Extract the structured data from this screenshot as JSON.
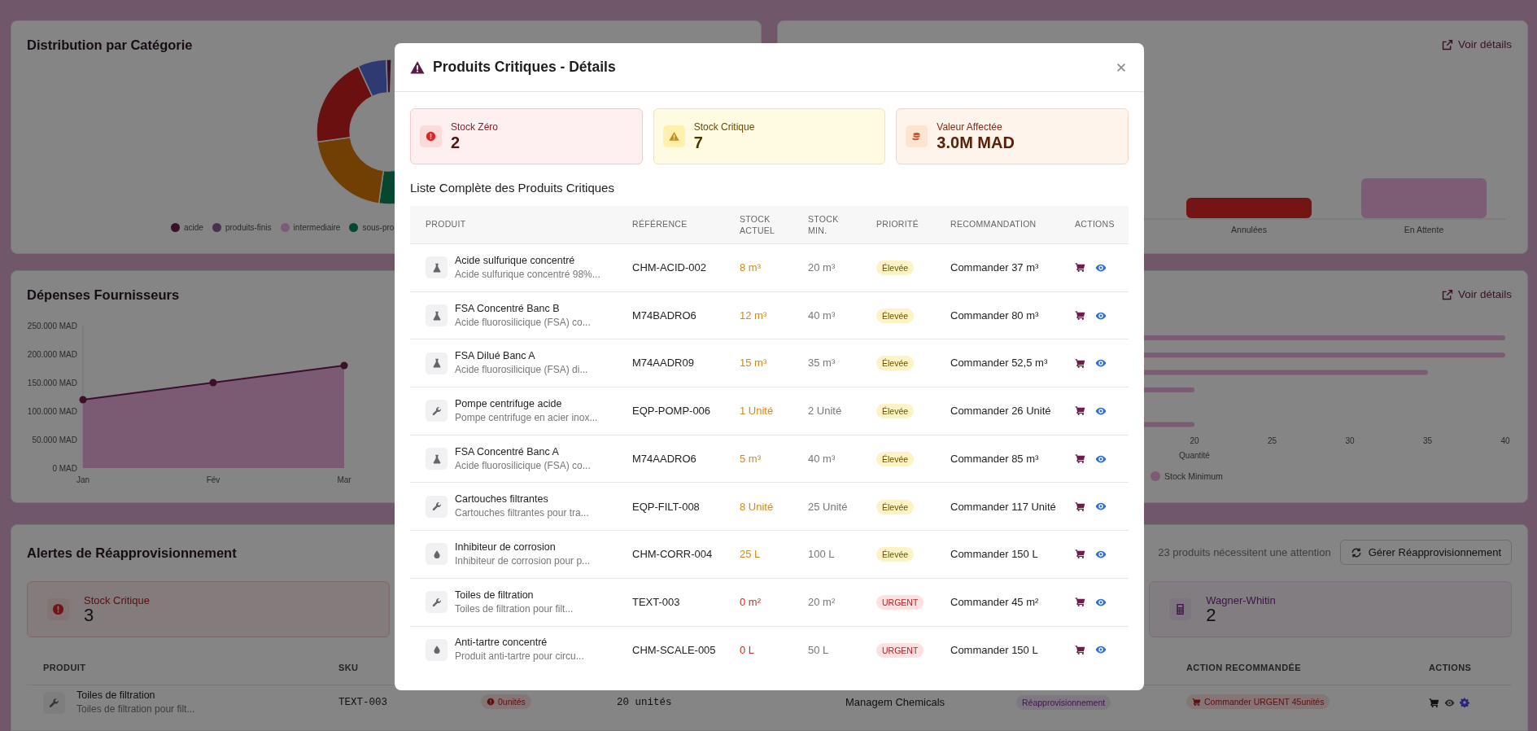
{
  "dashboard": {
    "category_card": {
      "title": "Distribution par Catégorie",
      "legend": [
        {
          "label": "acide",
          "color": "#3a1128"
        },
        {
          "label": "produits-finis",
          "color": "#4a3050"
        },
        {
          "label": "intermediaire",
          "color": "#7a5e75"
        },
        {
          "label": "sous-pro",
          "color": "#06472f"
        }
      ]
    },
    "orders_card": {
      "link": "Voir détails",
      "bars": [
        {
          "label": "Annulées",
          "color": "#741414"
        },
        {
          "label": "En Attente",
          "color": "#7d5c76"
        }
      ]
    },
    "expenses_card": {
      "title": "Dépenses Fournisseurs",
      "chart_data": {
        "type": "area",
        "categories": [
          "Jan",
          "Fév",
          "Mar"
        ],
        "ylim": [
          0,
          250
        ],
        "yticks": [
          {
            "value": 0,
            "label": "0 MAD"
          },
          {
            "value": 50,
            "label": "50.000 MAD"
          },
          {
            "value": 100,
            "label": "100.000 MAD"
          },
          {
            "value": 150,
            "label": "150.000 MAD"
          },
          {
            "value": 200,
            "label": "200.000 MAD"
          },
          {
            "value": 250,
            "label": "250.000 MAD"
          }
        ],
        "series": [
          {
            "color": "#3a1128",
            "values": [
              120,
              150,
              180
            ]
          }
        ]
      }
    },
    "stock_card": {
      "link": "Voir détails",
      "tick_labels": [
        "20",
        "25",
        "30",
        "35",
        "40"
      ],
      "axis_title": "Quantité",
      "legend": [
        {
          "label": "Stock Minimum",
          "color": "#7c5b74"
        }
      ]
    },
    "alerts_card": {
      "title": "Alertes de Réapprovisionnement",
      "summary": "23 produits nécessitent une attention",
      "button": "Gérer Réapprovisionnement",
      "stats": [
        {
          "kind": "critical",
          "label": "Stock Critique",
          "value": "3"
        },
        {
          "kind": "wagner",
          "label": "Wagner-Whitin",
          "value": "2"
        }
      ],
      "columns": [
        "PRODUIT",
        "SKU",
        "ACTION RECOMMANDÉE",
        "ACTIONS"
      ],
      "rows": [
        {
          "kind": "wrench",
          "name": "Toiles de filtration",
          "description": "Toiles de filtration pour filt...",
          "sku": "TEXT-003",
          "stock": "0unités",
          "minimum": "20 unités",
          "supplier": "Managem Chemicals",
          "method": "Réapprovisionnement",
          "action": "Commander URGENT 45unités"
        }
      ]
    }
  },
  "modal": {
    "title": "Produits Critiques - Détails",
    "stats": [
      {
        "kind": "zero",
        "label": "Stock Zéro",
        "value": "2"
      },
      {
        "kind": "critical",
        "label": "Stock Critique",
        "value": "7"
      },
      {
        "kind": "value",
        "label": "Valeur Affectée",
        "value": "3.0M MAD"
      }
    ],
    "list_title": "Liste Complète des Produits Critiques",
    "columns": [
      "PRODUIT",
      "RÉFÉRENCE",
      "STOCK ACTUEL",
      "STOCK MIN.",
      "PRIORITÉ",
      "RECOMMANDATION",
      "ACTIONS"
    ],
    "rows": [
      {
        "kind": "flask",
        "name": "Acide sulfurique concentré",
        "description": "Acide sulfurique concentré 98%...",
        "reference": "CHM-ACID-002",
        "stock": "8 m³",
        "minimum": "20 m³",
        "priority": {
          "label": "Élevée",
          "kind": "high"
        },
        "recommendation": "Commander 37 m³"
      },
      {
        "kind": "flask",
        "name": "FSA Concentré Banc B",
        "description": "Acide fluorosilicique (FSA) co...",
        "reference": "M74BADRO6",
        "stock": "12 m³",
        "minimum": "40 m³",
        "priority": {
          "label": "Élevée",
          "kind": "high"
        },
        "recommendation": "Commander 80 m³"
      },
      {
        "kind": "flask",
        "name": "FSA Dilué Banc A",
        "description": "Acide fluorosilicique (FSA) di...",
        "reference": "M74AADR09",
        "stock": "15 m³",
        "minimum": "35 m³",
        "priority": {
          "label": "Élevée",
          "kind": "high"
        },
        "recommendation": "Commander 52,5 m³"
      },
      {
        "kind": "wrench",
        "name": "Pompe centrifuge acide",
        "description": "Pompe centrifuge en acier inox...",
        "reference": "EQP-POMP-006",
        "stock": "1 Unité",
        "minimum": "2 Unité",
        "priority": {
          "label": "Élevée",
          "kind": "high"
        },
        "recommendation": "Commander 26 Unité"
      },
      {
        "kind": "flask",
        "name": "FSA Concentré Banc A",
        "description": "Acide fluorosilicique (FSA) co...",
        "reference": "M74AADRO6",
        "stock": "5 m³",
        "minimum": "40 m³",
        "priority": {
          "label": "Élevée",
          "kind": "high"
        },
        "recommendation": "Commander 85 m³"
      },
      {
        "kind": "wrench",
        "name": "Cartouches filtrantes",
        "description": "Cartouches filtrantes pour tra...",
        "reference": "EQP-FILT-008",
        "stock": "8 Unité",
        "minimum": "25 Unité",
        "priority": {
          "label": "Élevée",
          "kind": "high"
        },
        "recommendation": "Commander 117 Unité"
      },
      {
        "kind": "drop",
        "name": "Inhibiteur de corrosion",
        "description": "Inhibiteur de corrosion pour p...",
        "reference": "CHM-CORR-004",
        "stock": "25 L",
        "minimum": "100 L",
        "priority": {
          "label": "Élevée",
          "kind": "high"
        },
        "recommendation": "Commander 150 L"
      },
      {
        "kind": "wrench",
        "name": "Toiles de filtration",
        "description": "Toiles de filtration pour filt...",
        "reference": "TEXT-003",
        "stock": "0 m²",
        "minimum": "20 m²",
        "priority": {
          "label": "URGENT",
          "kind": "urgent"
        },
        "recommendation": "Commander 45 m²"
      },
      {
        "kind": "drop",
        "name": "Anti-tartre concentré",
        "description": "Produit anti-tartre pour circu...",
        "reference": "CHM-SCALE-005",
        "stock": "0 L",
        "minimum": "50 L",
        "priority": {
          "label": "URGENT",
          "kind": "urgent"
        },
        "recommendation": "Commander 150 L"
      }
    ]
  }
}
